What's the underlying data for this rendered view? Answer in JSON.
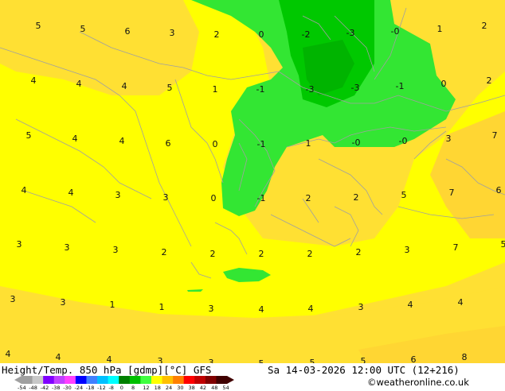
{
  "map": {
    "title": "Height/Temp. 850 hPa [gdmp][°C] GFS",
    "datetime": "Sa 14-03-2026 12:00 UTC (12+216)",
    "credit": "©weatheronline.co.uk",
    "colors": {
      "yellow": "#ffff00",
      "gold": "#ffe033",
      "orange_gold": "#ffd633",
      "green_light": "#33e633",
      "green_mid": "#00c800",
      "green_dark": "#00b400",
      "border_gray": "#a0a0a0"
    }
  },
  "colorbar": {
    "ticks": [
      "-54",
      "-48",
      "-42",
      "-38",
      "-30",
      "-24",
      "-18",
      "-12",
      "-8",
      "0",
      "8",
      "12",
      "18",
      "24",
      "30",
      "38",
      "42",
      "48",
      "54"
    ],
    "colors": [
      "#a0a0a0",
      "#c8c8c8",
      "#8000ff",
      "#c040ff",
      "#ff40ff",
      "#0000ff",
      "#4080ff",
      "#00c0ff",
      "#00ffff",
      "#008000",
      "#00c000",
      "#40ff40",
      "#ffff00",
      "#ffc000",
      "#ff8000",
      "#ff0000",
      "#c00000",
      "#800000",
      "#400000"
    ]
  },
  "values": [
    {
      "t": "5"
    },
    {
      "t": "5"
    },
    {
      "t": "6"
    },
    {
      "t": "3"
    },
    {
      "t": "2"
    },
    {
      "t": "0"
    },
    {
      "t": "-2"
    },
    {
      "t": "-3"
    },
    {
      "t": "-0"
    },
    {
      "t": "1"
    },
    {
      "t": "2"
    },
    {
      "t": "4"
    },
    {
      "t": "4"
    },
    {
      "t": "4"
    },
    {
      "t": "5"
    },
    {
      "t": "1"
    },
    {
      "t": "-1"
    },
    {
      "t": "-3"
    },
    {
      "t": "-3"
    },
    {
      "t": "-1"
    },
    {
      "t": "0"
    },
    {
      "t": "2"
    },
    {
      "t": "5"
    },
    {
      "t": "4"
    },
    {
      "t": "4"
    },
    {
      "t": "6"
    },
    {
      "t": "0"
    },
    {
      "t": "-1"
    },
    {
      "t": "1"
    },
    {
      "t": "-0"
    },
    {
      "t": "-0"
    },
    {
      "t": "3"
    },
    {
      "t": "7"
    },
    {
      "t": "4"
    },
    {
      "t": "4"
    },
    {
      "t": "3"
    },
    {
      "t": "3"
    },
    {
      "t": "0"
    },
    {
      "t": "-1"
    },
    {
      "t": "2"
    },
    {
      "t": "2"
    },
    {
      "t": "5"
    },
    {
      "t": "7"
    },
    {
      "t": "6"
    },
    {
      "t": "3"
    },
    {
      "t": "3"
    },
    {
      "t": "3"
    },
    {
      "t": "2"
    },
    {
      "t": "2"
    },
    {
      "t": "2"
    },
    {
      "t": "2"
    },
    {
      "t": "2"
    },
    {
      "t": "3"
    },
    {
      "t": "7"
    },
    {
      "t": "5"
    },
    {
      "t": "3"
    },
    {
      "t": "3"
    },
    {
      "t": "1"
    },
    {
      "t": "1"
    },
    {
      "t": "3"
    },
    {
      "t": "4"
    },
    {
      "t": "4"
    },
    {
      "t": "3"
    },
    {
      "t": "4"
    },
    {
      "t": "4"
    },
    {
      "t": "4"
    },
    {
      "t": "4"
    },
    {
      "t": "4"
    },
    {
      "t": "3"
    },
    {
      "t": "3"
    },
    {
      "t": "5"
    },
    {
      "t": "5"
    },
    {
      "t": "5"
    },
    {
      "t": "6"
    },
    {
      "t": "8"
    }
  ]
}
